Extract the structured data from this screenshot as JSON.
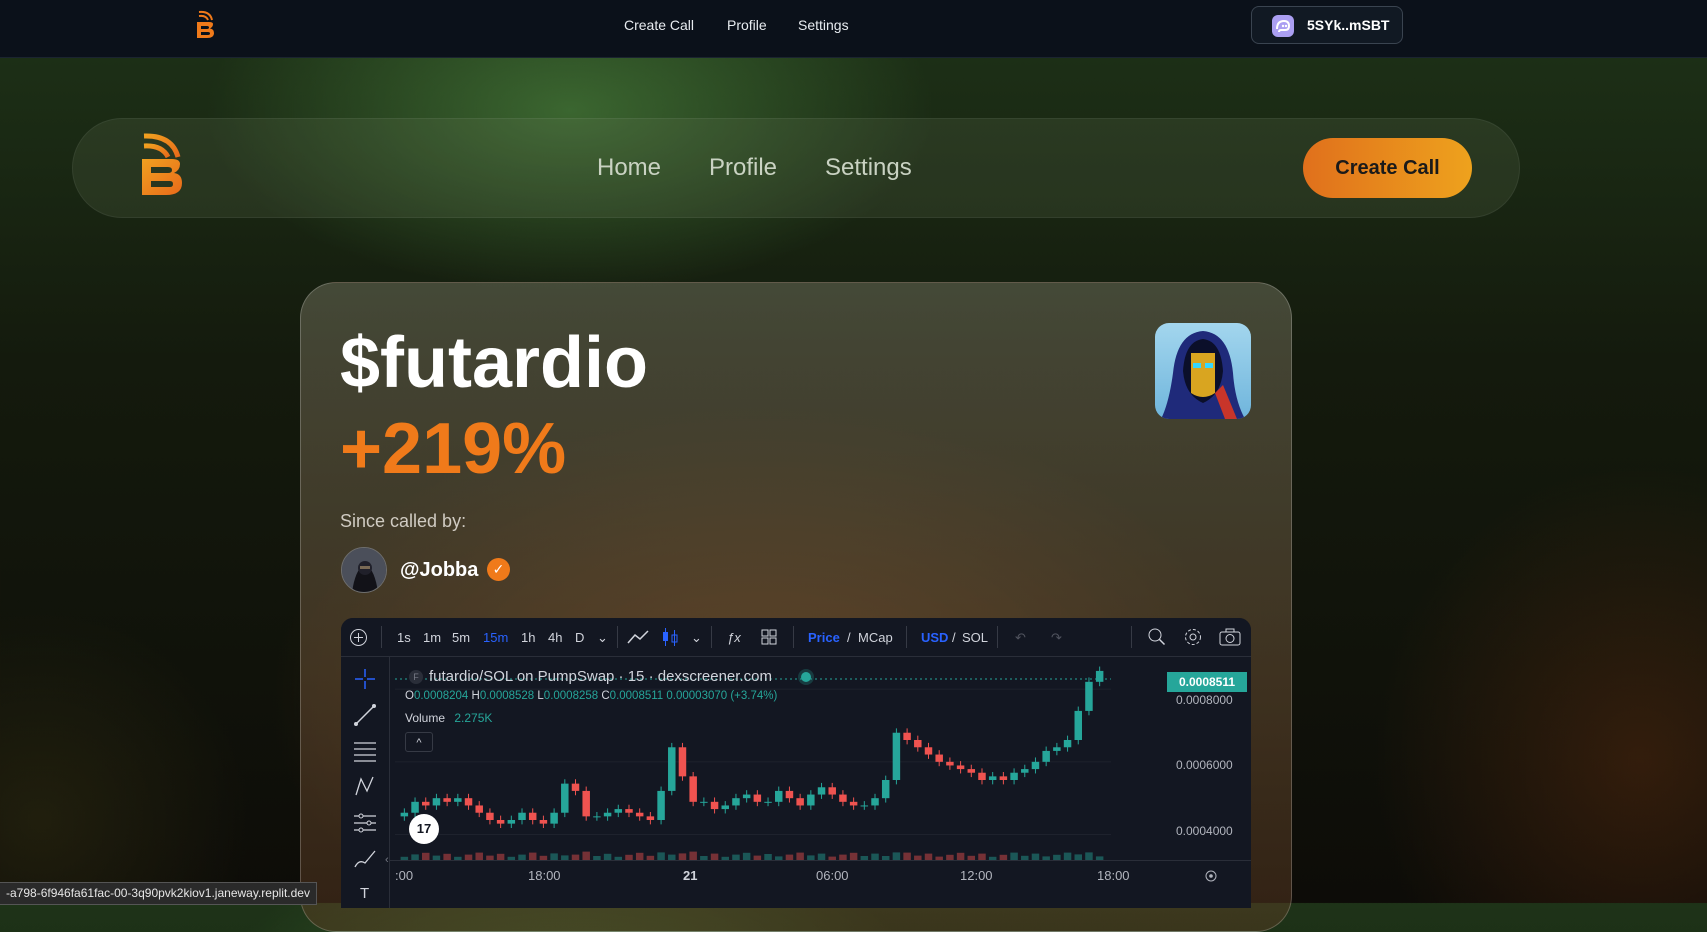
{
  "topbar": {
    "nav": [
      "Create Call",
      "Profile",
      "Settings"
    ],
    "wallet_label": "5SYk..mSBT"
  },
  "navbar": {
    "links": [
      "Home",
      "Profile",
      "Settings"
    ],
    "cta_label": "Create Call"
  },
  "call": {
    "ticker": "$futardio",
    "change": "+219%",
    "since_label": "Since called by:",
    "caller_handle": "@Jobba"
  },
  "chart": {
    "toolbar": {
      "intervals": [
        "1s",
        "1m",
        "5m",
        "15m",
        "1h",
        "4h",
        "D"
      ],
      "active_interval": "15m",
      "price_label": "Price",
      "mcap_label": "MCap",
      "usd_label": "USD",
      "sol_label": "SOL"
    },
    "legend_title": "futardio/SOL on PumpSwap · 15 · dexscreener.com",
    "ohlc": {
      "o": "0.0008204",
      "h": "0.0008528",
      "l": "0.0008258",
      "c": "0.0008511",
      "chg": "0.00003070 (+3.74%)"
    },
    "volume_label": "Volume",
    "volume_value": "2.275K",
    "last_price": "0.0008511",
    "accent": "#26a69a",
    "down": "#ef5350"
  },
  "chart_data": {
    "type": "candlestick",
    "y_ticks": [
      "0.0008000",
      "0.0006000",
      "0.0004000"
    ],
    "x_ticks": [
      ":00",
      "18:00",
      "21",
      "06:00",
      "12:00",
      "18:00"
    ],
    "closes": [
      0.00046,
      0.00049,
      0.00048,
      0.0005,
      0.00049,
      0.0005,
      0.00048,
      0.00046,
      0.00044,
      0.00043,
      0.00044,
      0.00046,
      0.00044,
      0.00043,
      0.00046,
      0.00054,
      0.00052,
      0.00045,
      0.00045,
      0.00046,
      0.00047,
      0.00046,
      0.00045,
      0.00044,
      0.00052,
      0.00064,
      0.00056,
      0.00049,
      0.00049,
      0.00047,
      0.00048,
      0.0005,
      0.00051,
      0.00049,
      0.00049,
      0.00052,
      0.0005,
      0.00048,
      0.00051,
      0.00053,
      0.00051,
      0.00049,
      0.00048,
      0.00048,
      0.0005,
      0.00055,
      0.00068,
      0.00066,
      0.00064,
      0.00062,
      0.0006,
      0.00059,
      0.00058,
      0.00057,
      0.00055,
      0.00056,
      0.00055,
      0.00057,
      0.00058,
      0.0006,
      0.00063,
      0.00064,
      0.00066,
      0.00074,
      0.00082,
      0.00085
    ],
    "ylim": [
      0.00033,
      0.00088
    ]
  }
}
